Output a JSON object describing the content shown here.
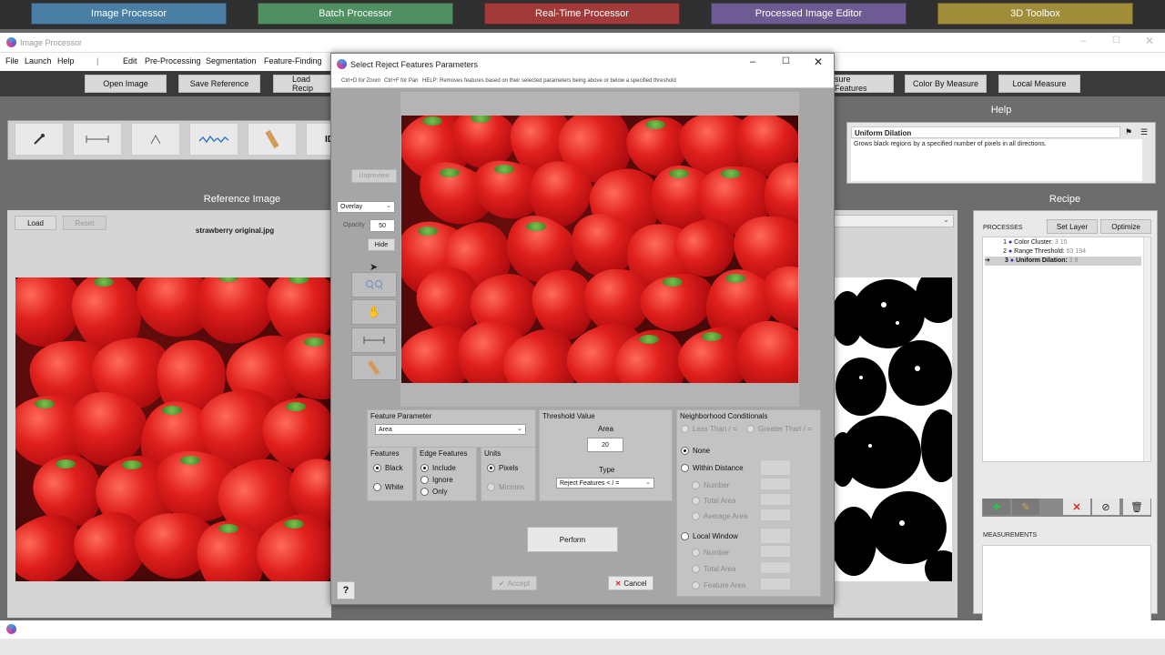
{
  "launcher": {
    "buttons": [
      {
        "label": "Image Processor",
        "color": "#4a7ea5"
      },
      {
        "label": "Batch Processor",
        "color": "#4f8f62"
      },
      {
        "label": "Real-Time Processor",
        "color": "#a23a3a"
      },
      {
        "label": "Processed Image Editor",
        "color": "#6e5b93"
      },
      {
        "label": "3D Toolbox",
        "color": "#a08d3a"
      }
    ]
  },
  "main_window": {
    "title": "Image Processor",
    "menu": [
      "File",
      "Launch",
      "Help",
      "|",
      "Edit",
      "Pre-Processing",
      "Segmentation",
      "Feature-Finding"
    ],
    "toolbar": {
      "open_image": "Open Image",
      "save_reference": "Save Reference",
      "load_recipe": "Load Recip",
      "measure_features": "sure Features",
      "color_by_measure": "Color By Measure",
      "local_measure": "Local Measure"
    },
    "id_tool": "ID",
    "reference": {
      "title": "Reference Image",
      "load": "Load",
      "reset": "Reset",
      "filename": "strawberry original.jpg"
    },
    "help": {
      "title": "Help",
      "heading": "Uniform Dilation",
      "body": "Grows black regions by a specified number of pixels in all directions."
    },
    "recipe": {
      "title": "Recipe",
      "processes_label": "PROCESSES",
      "set_layer": "Set Layer",
      "optimize": "Optimize",
      "items": [
        {
          "num": "1",
          "name": "Color Cluster:",
          "params": "3 15",
          "dot": "#2d2dc8",
          "arrow": ""
        },
        {
          "num": "2",
          "name": "Range Threshold:",
          "params": "53 194",
          "dot": "#2d2dc8",
          "arrow": ""
        },
        {
          "num": "3",
          "name": "Uniform Dilation:",
          "params": "2 8",
          "dot": "#2d2dc8",
          "arrow": "➔"
        }
      ],
      "measurements_label": "MEASUREMENTS"
    }
  },
  "dialog": {
    "title": "Select Reject Features Parameters",
    "hint_zoom": "Ctrl+D for Zoom",
    "hint_pan": "Ctrl+F for Pan",
    "hint_help": "HELP: Removes features based on their selected parameters being above or below a specified threshold",
    "unpreview": "Unpreview",
    "overlay_select": "Overlay",
    "opacity_label": "Opacity",
    "opacity_value": "50",
    "hide": "Hide",
    "feature_parameter": {
      "label": "Feature Parameter",
      "value": "Area"
    },
    "features": {
      "label": "Features",
      "options": [
        "Black",
        "White"
      ],
      "selected": "Black"
    },
    "edge_features": {
      "label": "Edge Features",
      "options": [
        "Include",
        "Ignore",
        "Only"
      ],
      "selected": "Include"
    },
    "units": {
      "label": "Units",
      "options": [
        "Pixels",
        "Microns"
      ],
      "selected": "Pixels"
    },
    "threshold": {
      "label": "Threshold Value",
      "area_label": "Area",
      "area_value": "20",
      "type_label": "Type",
      "type_value": "Reject Features < / ="
    },
    "neighborhood": {
      "label": "Neighborhood Conditionals",
      "less_than": "Less Than / =",
      "greater_than": "Greater Than / =",
      "none": "None",
      "within_distance": "Within Distance",
      "wd_options": [
        "Number",
        "Total Area",
        "Average Area"
      ],
      "local_window": "Local Window",
      "lw_options": [
        "Number",
        "Total Area",
        "Feature Area"
      ]
    },
    "perform": "Perform",
    "accept": "Accept",
    "cancel": "Cancel",
    "help_btn": "?"
  }
}
